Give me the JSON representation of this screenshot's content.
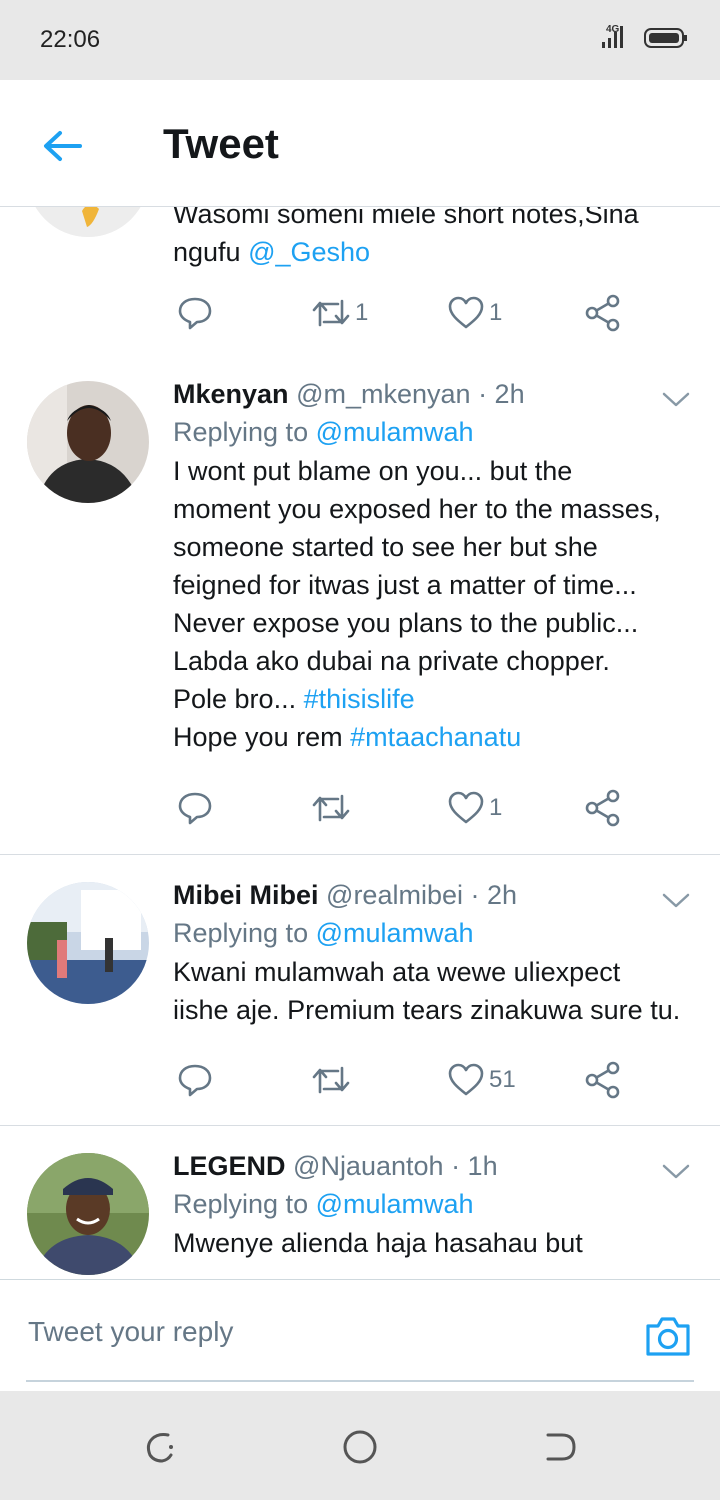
{
  "status_bar": {
    "time": "22:06",
    "network": "4G"
  },
  "header": {
    "title": "Tweet"
  },
  "colors": {
    "accent": "#1da1f2",
    "text": "#14171a",
    "muted": "#657786",
    "divider": "#d8dde2"
  },
  "tweets": [
    {
      "partial": true,
      "text_line1": "Wasomi someni miele short notes,Sina",
      "text_line2_prefix": "ngufu ",
      "mention": "@_Gesho",
      "retweets": "1",
      "likes": "1"
    },
    {
      "name": "Mkenyan",
      "handle": "@m_mkenyan",
      "time": "· 2h",
      "replying_prefix": "Replying to ",
      "replying_to": "@mulamwah",
      "lines": [
        "I wont put blame on you... but the",
        "moment you exposed her to the masses,",
        "someone started to see her but she",
        "feigned for itwas just a matter of time...",
        "Never expose you plans to the public...",
        "Labda ako dubai na private chopper."
      ],
      "line7_prefix": "Pole bro... ",
      "hashtag1": "#thisislife",
      "line8_prefix": "Hope you rem ",
      "hashtag2": "#mtaachanatu",
      "retweets": "",
      "likes": "1"
    },
    {
      "name": "Mibei Mibei",
      "handle": "@realmibei",
      "time": "· 2h",
      "replying_prefix": "Replying to ",
      "replying_to": "@mulamwah",
      "lines": [
        "Kwani mulamwah ata wewe uliexpect",
        "iishe aje. Premium tears zinakuwa sure tu."
      ],
      "retweets": "",
      "likes": "51"
    },
    {
      "name": "LEGEND",
      "handle": "@Njauantoh",
      "time": "· 1h",
      "replying_prefix": "Replying to ",
      "replying_to": "@mulamwah",
      "lines": [
        "Mwenye alienda haja hasahau but"
      ]
    }
  ],
  "reply_bar": {
    "placeholder": "Tweet your reply"
  },
  "icons": [
    "back-arrow-icon",
    "reply-icon",
    "retweet-icon",
    "like-icon",
    "share-icon",
    "chevron-down-icon",
    "camera-icon",
    "recent-apps-icon",
    "home-icon",
    "back-icon"
  ]
}
